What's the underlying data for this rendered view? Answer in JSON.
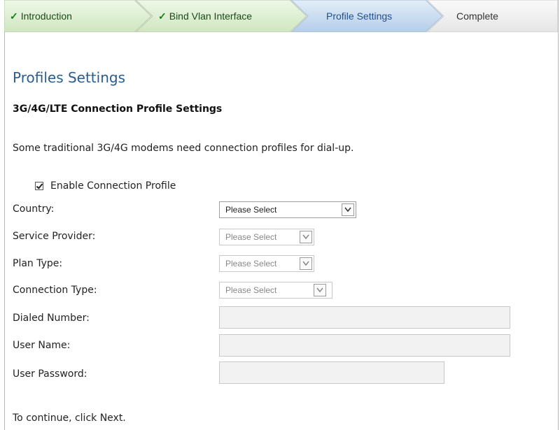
{
  "wizard": {
    "steps": [
      {
        "label": "Introduction",
        "state": "done"
      },
      {
        "label": "Bind Vlan Interface",
        "state": "done"
      },
      {
        "label": "Profile Settings",
        "state": "active"
      },
      {
        "label": "Complete",
        "state": "todo"
      }
    ]
  },
  "page": {
    "title": "Profiles Settings",
    "section_title": "3G/4G/LTE Connection Profile Settings",
    "description": "Some traditional 3G/4G modems need connection profiles for dial-up.",
    "enable_label": "Enable Connection Profile",
    "enable_checked": true,
    "footer": "To continue, click Next."
  },
  "form": {
    "country": {
      "label": "Country:",
      "value": "Please Select"
    },
    "service_provider": {
      "label": "Service Provider:",
      "value": "Please Select"
    },
    "plan_type": {
      "label": "Plan Type:",
      "value": "Please Select"
    },
    "connection_type": {
      "label": "Connection Type:",
      "value": "Please Select"
    },
    "dialed_number": {
      "label": "Dialed Number:",
      "value": ""
    },
    "user_name": {
      "label": "User Name:",
      "value": ""
    },
    "user_password": {
      "label": "User Password:",
      "value": ""
    }
  },
  "colors": {
    "done_step": "#dcefcf",
    "active_step": "#c5d9ee",
    "todo_step": "#efefef",
    "title": "#2a5d8c"
  }
}
